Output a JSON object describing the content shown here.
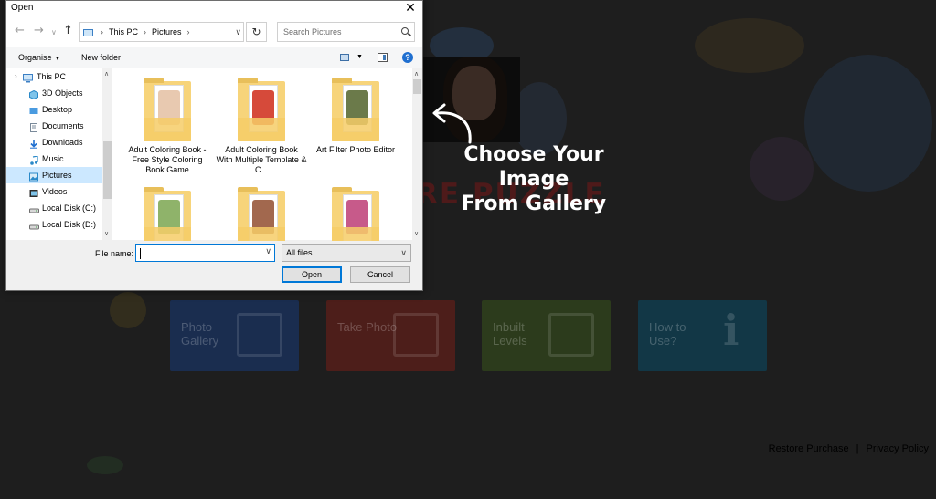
{
  "dialog": {
    "title": "Open",
    "close_glyph": "✕",
    "nav": {
      "back_glyph": "←",
      "forward_glyph": "→",
      "recent_glyph": "∨",
      "up_glyph": "↑",
      "breadcrumbs": [
        "This PC",
        "Pictures"
      ],
      "breadcrumb_sep": "›",
      "refresh_glyph": "↻",
      "address_dd_glyph": "∨"
    },
    "search": {
      "placeholder": "Search Pictures"
    },
    "toolbar": {
      "organise_label": "Organise",
      "dd_glyph": "▼",
      "new_folder_label": "New folder",
      "help_glyph": "?"
    },
    "sidebar": {
      "items": [
        {
          "label": "This PC",
          "icon": "computer-icon",
          "level": "top",
          "selected": false
        },
        {
          "label": "3D Objects",
          "icon": "cube-icon",
          "level": "child",
          "selected": false
        },
        {
          "label": "Desktop",
          "icon": "desktop-icon",
          "level": "child",
          "selected": false
        },
        {
          "label": "Documents",
          "icon": "document-icon",
          "level": "child",
          "selected": false
        },
        {
          "label": "Downloads",
          "icon": "download-icon",
          "level": "child",
          "selected": false
        },
        {
          "label": "Music",
          "icon": "music-icon",
          "level": "child",
          "selected": false
        },
        {
          "label": "Pictures",
          "icon": "pictures-icon",
          "level": "child",
          "selected": true
        },
        {
          "label": "Videos",
          "icon": "video-icon",
          "level": "child",
          "selected": false
        },
        {
          "label": "Local Disk (C:)",
          "icon": "drive-icon",
          "level": "child",
          "selected": false
        },
        {
          "label": "Local Disk (D:)",
          "icon": "drive-icon",
          "level": "child",
          "selected": false
        }
      ],
      "expand_glyph": "›",
      "scroll_up": "∧",
      "scroll_down": "∨"
    },
    "files": [
      {
        "name": "Adult Coloring Book - Free Style Coloring Book Game",
        "color": "#e8c9b0"
      },
      {
        "name": "Adult Coloring Book With Multiple Template & C...",
        "color": "#d64a3a"
      },
      {
        "name": "Art Filter Photo Editor",
        "color": "#6b7a4a"
      },
      {
        "name": "",
        "color": "#8fb36a"
      },
      {
        "name": "",
        "color": "#a2684e"
      },
      {
        "name": "",
        "color": "#c75a8a"
      }
    ],
    "file_name_label": "File name:",
    "file_name_value": "",
    "file_type_value": "All files",
    "open_label": "Open",
    "cancel_label": "Cancel",
    "accent_color": "#0078d7"
  },
  "hint": {
    "text_line1": "Choose Your Image",
    "text_line2": "From Gallery"
  },
  "background": {
    "logo_text": "RE PUZZLE",
    "cards": [
      {
        "label": "Photo Gallery",
        "color": "#1a2d4f"
      },
      {
        "label": "Take Photo",
        "color": "#4d1e1a"
      },
      {
        "label": "Inbuilt Levels",
        "color": "#2c3b1c"
      },
      {
        "label": "How to Use?",
        "color": "#123746"
      }
    ],
    "howto_glyph": "i",
    "footer": {
      "restore_label": "Restore Purchase",
      "separator": "|",
      "privacy_label": "Privacy Policy"
    }
  }
}
